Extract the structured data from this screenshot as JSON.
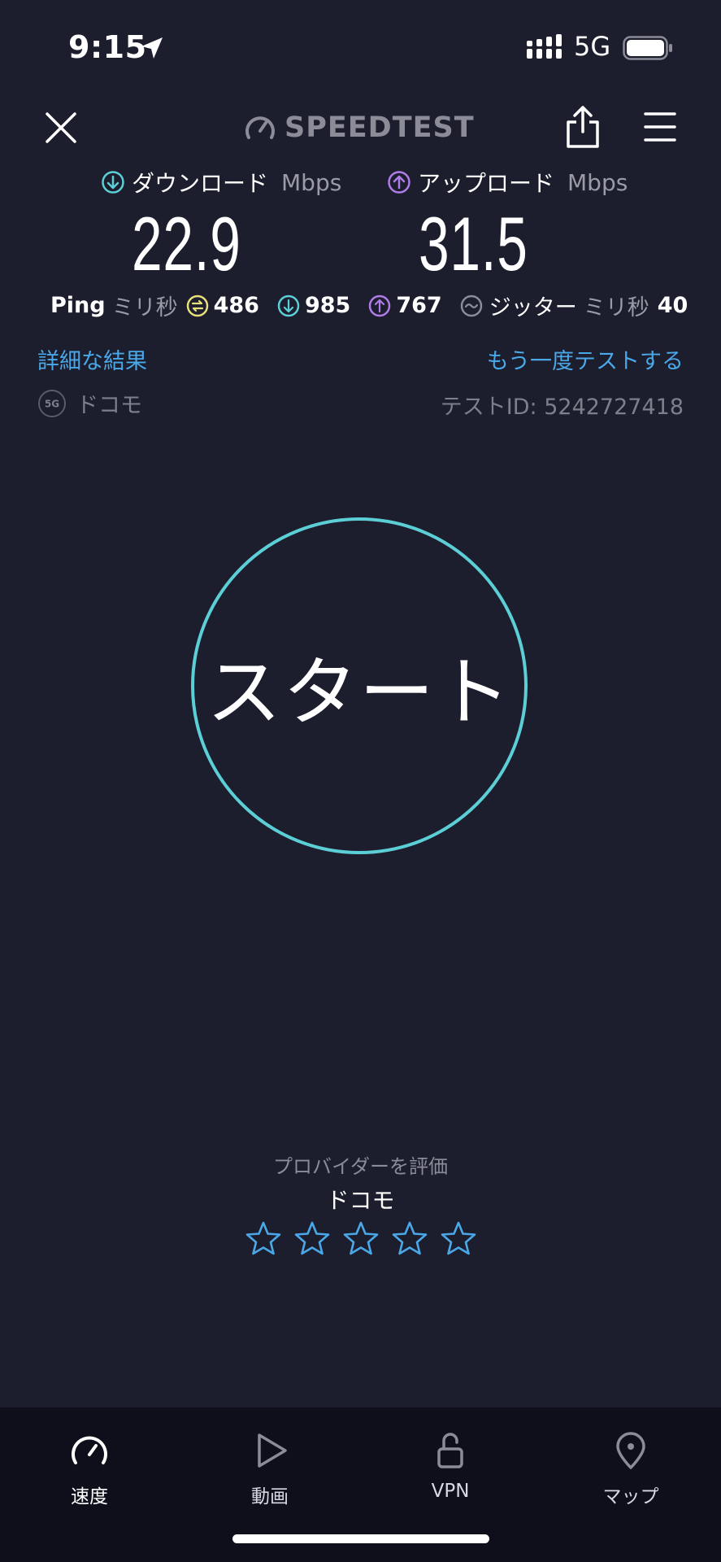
{
  "status_bar": {
    "time": "9:15",
    "network": "5G",
    "icons": [
      "location-arrow-icon",
      "signal-icon",
      "battery-icon"
    ]
  },
  "header": {
    "logo_text": "SPEEDTEST",
    "icons": [
      "close-icon",
      "speedometer-icon",
      "share-icon",
      "menu-icon"
    ]
  },
  "download": {
    "label": "ダウンロード",
    "unit": "Mbps",
    "value": "22.9",
    "icon": "download-arrow-icon",
    "color": "#5ccfd6"
  },
  "upload": {
    "label": "アップロード",
    "unit": "Mbps",
    "value": "31.5",
    "icon": "upload-arrow-icon",
    "color": "#b07ce8"
  },
  "ping": {
    "label": "Ping",
    "unit": "ミリ秒",
    "idle": "486",
    "download": "985",
    "upload": "767",
    "jitter_label": "ジッター",
    "jitter_unit": "ミリ秒",
    "jitter": "40",
    "idle_color": "#e8e07a"
  },
  "links": {
    "details": "詳細な結果",
    "retest": "もう一度テストする",
    "color": "#4aa8e8"
  },
  "connection": {
    "badge": "5G",
    "carrier": "ドコモ",
    "test_id": "テストID: 5242727418"
  },
  "start_button": {
    "label": "スタート",
    "ring_color": "#5ccfd6"
  },
  "rating": {
    "title": "プロバイダーを評価",
    "provider": "ドコモ",
    "max_stars": 5,
    "selected": 0,
    "star_color": "#4aa8e8"
  },
  "bottom_nav": {
    "items": [
      {
        "label": "速度",
        "icon": "speedometer-icon",
        "active": true
      },
      {
        "label": "動画",
        "icon": "play-icon",
        "active": false
      },
      {
        "label": "VPN",
        "icon": "unlock-icon",
        "active": false
      },
      {
        "label": "マップ",
        "icon": "map-pin-icon",
        "active": false
      }
    ]
  }
}
